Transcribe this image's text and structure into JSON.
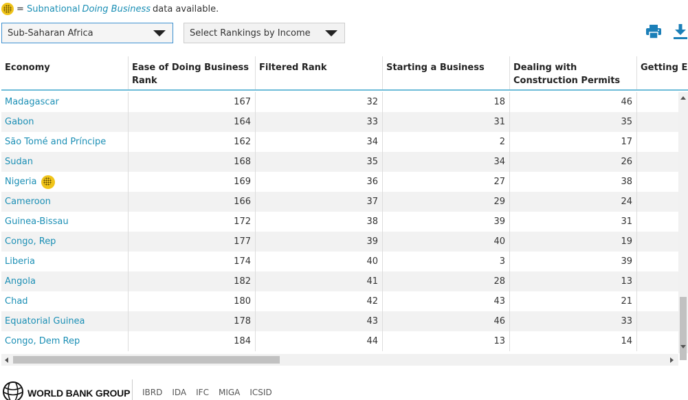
{
  "legend": {
    "equals": "=",
    "subnational": "Subnational",
    "doing_business": "Doing Business",
    "tail": "data available.",
    "icon": "subnational-globe-icon"
  },
  "filters": {
    "region": "Sub-Saharan Africa",
    "income": "Select Rankings by Income"
  },
  "toolbar": {
    "print_icon": "print-icon",
    "download_icon": "download-icon"
  },
  "table": {
    "headers": [
      "Economy",
      "Ease of Doing Business Rank",
      "Filtered Rank",
      "Starting a Business",
      "Dealing with Construction Permits",
      "Getting Ele"
    ],
    "rows": [
      {
        "economy": "Madagascar",
        "ease": "167",
        "filtered": "32",
        "starting": "18",
        "construction": "46",
        "subnational": false
      },
      {
        "economy": "Gabon",
        "ease": "164",
        "filtered": "33",
        "starting": "31",
        "construction": "35",
        "subnational": false
      },
      {
        "economy": "São Tomé and Príncipe",
        "ease": "162",
        "filtered": "34",
        "starting": "2",
        "construction": "17",
        "subnational": false
      },
      {
        "economy": "Sudan",
        "ease": "168",
        "filtered": "35",
        "starting": "34",
        "construction": "26",
        "subnational": false
      },
      {
        "economy": "Nigeria",
        "ease": "169",
        "filtered": "36",
        "starting": "27",
        "construction": "38",
        "subnational": true
      },
      {
        "economy": "Cameroon",
        "ease": "166",
        "filtered": "37",
        "starting": "29",
        "construction": "24",
        "subnational": false
      },
      {
        "economy": "Guinea-Bissau",
        "ease": "172",
        "filtered": "38",
        "starting": "39",
        "construction": "31",
        "subnational": false
      },
      {
        "economy": "Congo, Rep",
        "ease": "177",
        "filtered": "39",
        "starting": "40",
        "construction": "19",
        "subnational": false
      },
      {
        "economy": "Liberia",
        "ease": "174",
        "filtered": "40",
        "starting": "3",
        "construction": "39",
        "subnational": false
      },
      {
        "economy": "Angola",
        "ease": "182",
        "filtered": "41",
        "starting": "28",
        "construction": "13",
        "subnational": false
      },
      {
        "economy": "Chad",
        "ease": "180",
        "filtered": "42",
        "starting": "43",
        "construction": "21",
        "subnational": false
      },
      {
        "economy": "Equatorial Guinea",
        "ease": "178",
        "filtered": "43",
        "starting": "46",
        "construction": "33",
        "subnational": false
      },
      {
        "economy": "Congo, Dem Rep",
        "ease": "184",
        "filtered": "44",
        "starting": "13",
        "construction": "14",
        "subnational": false
      }
    ]
  },
  "footer": {
    "brand": "WORLD BANK GROUP",
    "logo_icon": "world-bank-globe-icon",
    "links": [
      "IBRD",
      "IDA",
      "IFC",
      "MIGA",
      "ICSID"
    ]
  },
  "colors": {
    "link": "#1b8fb5",
    "header_rule": "#6cbbd8",
    "alt_row": "#f2f2f2",
    "icon_accent": "#1b7fb8"
  }
}
